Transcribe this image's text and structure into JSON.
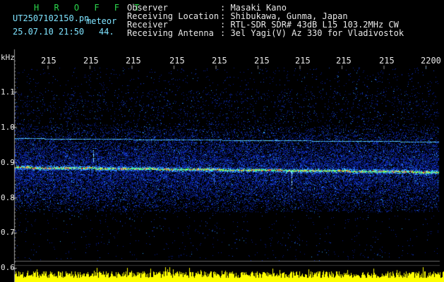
{
  "header": {
    "app_title": "H R O F F T",
    "filename": "UT2507102150.pn",
    "mode": "meteor",
    "datetime": "25.07.10 21:50",
    "count": "44.",
    "fields": [
      {
        "label": "Observer",
        "value": ": Masaki Kano"
      },
      {
        "label": "Receiving Location",
        "value": ": Shibukawa, Gunma, Japan"
      },
      {
        "label": "Receiver",
        "value": ": RTL-SDR SDR# 43dB L15 103.2MHz CW"
      },
      {
        "label": "Receiving Antenna",
        "value": ": 3el Yagi(V) Az 330 for Vladivostok"
      }
    ]
  },
  "axes": {
    "y_unit": "kHz",
    "y_labels": [
      "1.1",
      "1.0",
      "0.9",
      "0.8",
      "0.7",
      "0.6"
    ],
    "top_ticks": [
      "215",
      "215",
      "215",
      "215",
      "215",
      "215",
      "215",
      "215",
      "215",
      "2200"
    ]
  },
  "colors": {
    "background": "#000000",
    "echo_line": "#31d3ff",
    "baseline_noise": "#ffff00",
    "grid": "#3a3a3a"
  }
}
